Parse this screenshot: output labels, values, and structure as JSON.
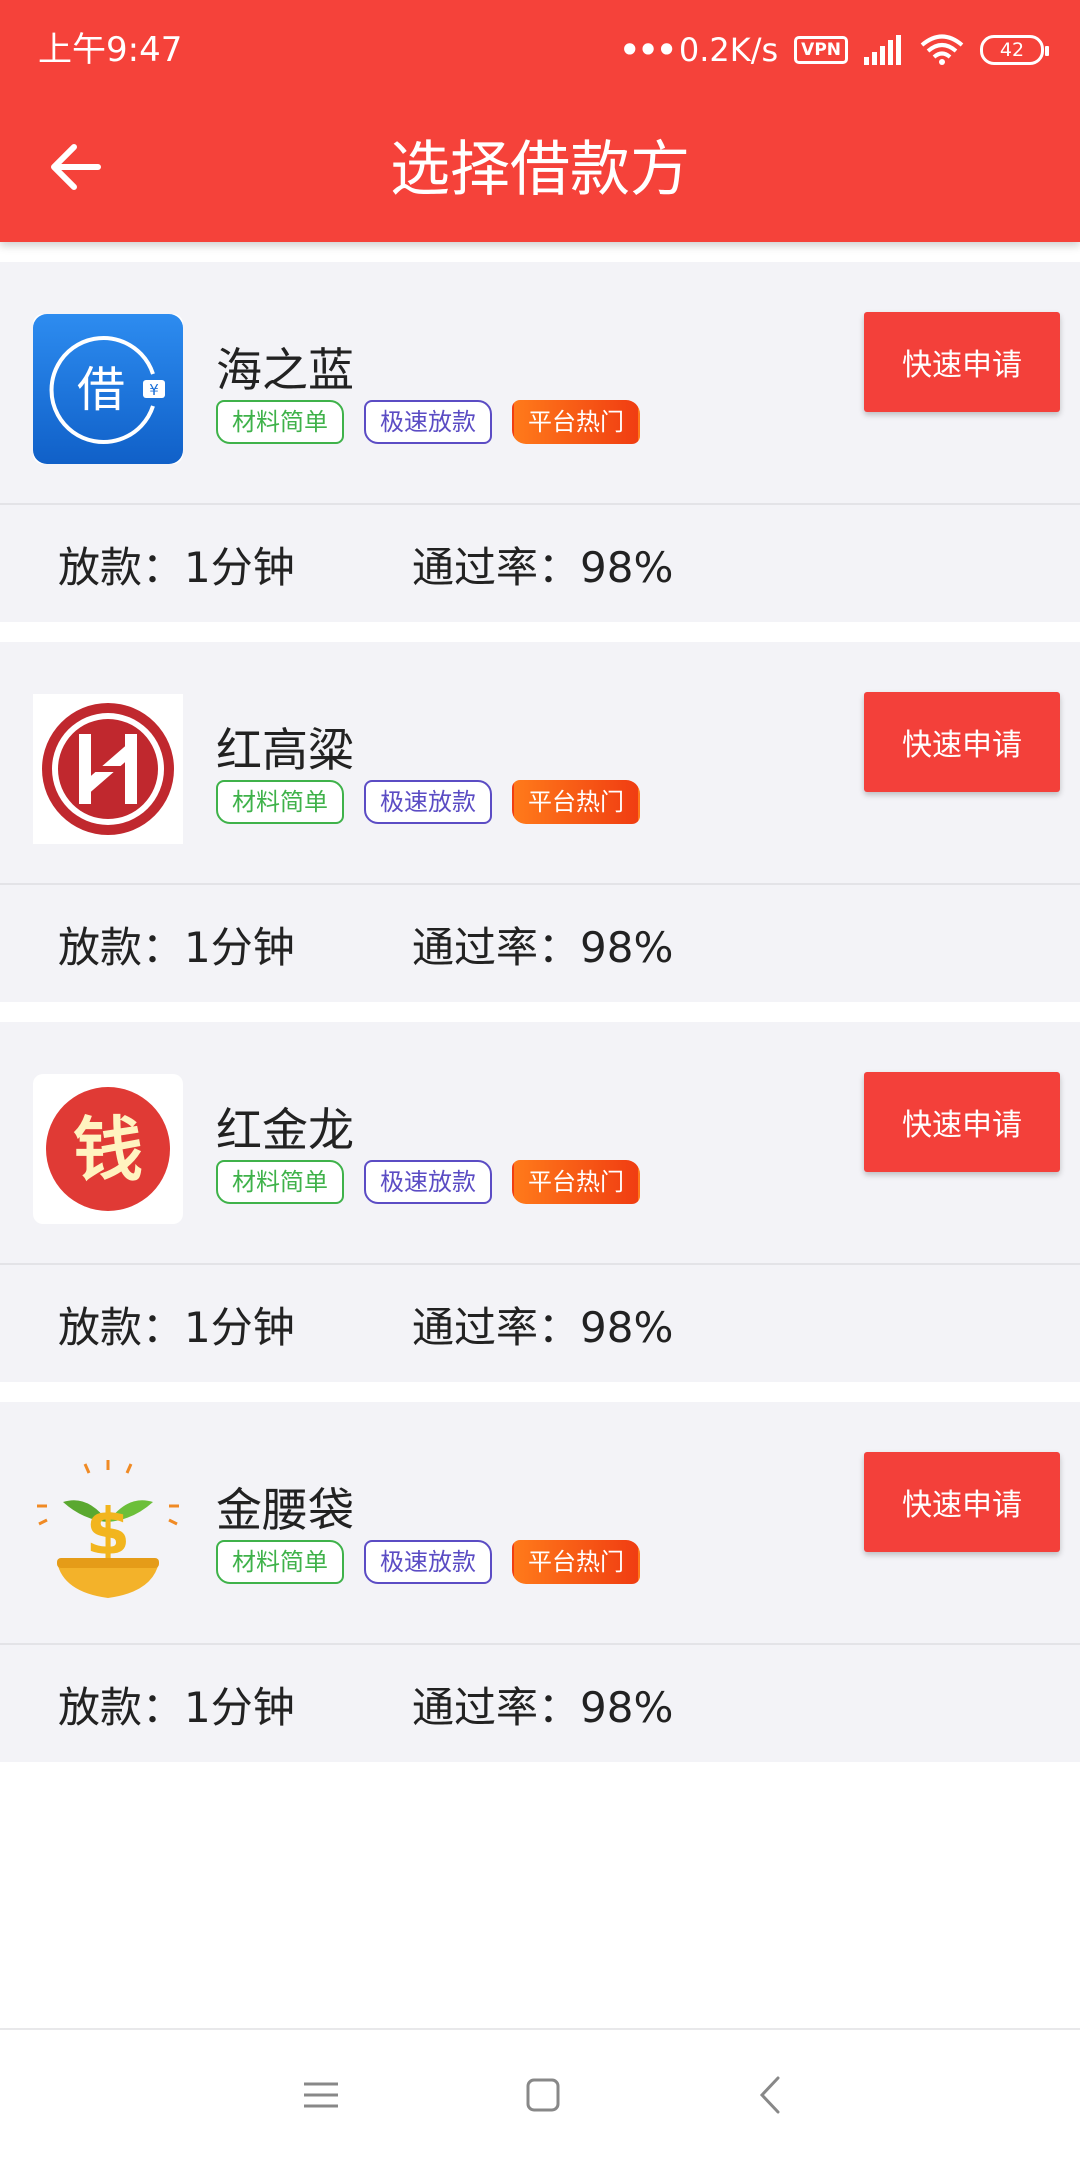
{
  "status_bar": {
    "time": "上午9:47",
    "speed": "0.2K/s",
    "vpn": "VPN",
    "battery": "42"
  },
  "header": {
    "title": "选择借款方"
  },
  "colors": {
    "primary_red": "#f5423a",
    "tag_green": "#3fb24a",
    "tag_purple": "#5b4cc4",
    "tag_hot": "#f45a18"
  },
  "lenders": [
    {
      "name": "海之蓝",
      "logo": "haizhilan-logo",
      "tags": [
        "材料简单",
        "极速放款",
        "平台热门"
      ],
      "button": "快速申请",
      "loan_time": "放款：1分钟",
      "pass_rate": "通过率：98%"
    },
    {
      "name": "红高粱",
      "logo": "honggaoliang-logo",
      "tags": [
        "材料简单",
        "极速放款",
        "平台热门"
      ],
      "button": "快速申请",
      "loan_time": "放款：1分钟",
      "pass_rate": "通过率：98%"
    },
    {
      "name": "红金龙",
      "logo": "hongjinlong-logo",
      "tags": [
        "材料简单",
        "极速放款",
        "平台热门"
      ],
      "button": "快速申请",
      "loan_time": "放款：1分钟",
      "pass_rate": "通过率：98%"
    },
    {
      "name": "金腰袋",
      "logo": "jinyaodai-logo",
      "tags": [
        "材料简单",
        "极速放款",
        "平台热门"
      ],
      "button": "快速申请",
      "loan_time": "放款：1分钟",
      "pass_rate": "通过率：98%"
    }
  ],
  "logo_text": {
    "haizhilan": "借",
    "haizhilan_small": "¥",
    "hongjinlong": "钱",
    "jinyaodai": "$"
  }
}
